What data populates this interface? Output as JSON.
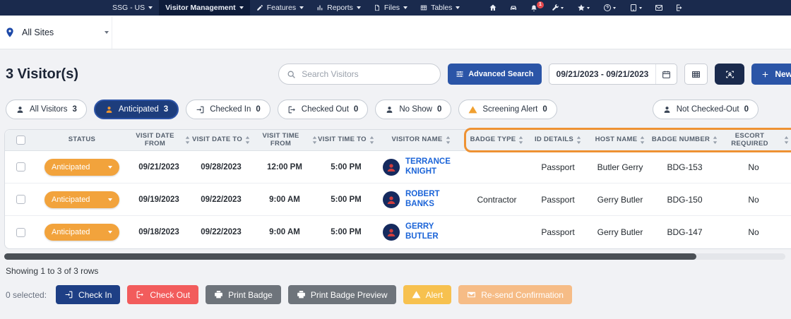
{
  "topnav": {
    "site_menu": "SSG - US",
    "module_menu": "Visitor Management",
    "menus": [
      {
        "label": "Features"
      },
      {
        "label": "Reports"
      },
      {
        "label": "Files"
      },
      {
        "label": "Tables"
      }
    ],
    "notification_count": "1"
  },
  "sitebar": {
    "site_selector": "All Sites"
  },
  "toolbar": {
    "title": "3 Visitor(s)",
    "search_placeholder": "Search Visitors",
    "advanced_search": "Advanced Search",
    "date_range": "09/21/2023 - 09/21/2023",
    "new_button": "New"
  },
  "filters": [
    {
      "label": "All Visitors",
      "count": "3"
    },
    {
      "label": "Anticipated",
      "count": "3"
    },
    {
      "label": "Checked In",
      "count": "0"
    },
    {
      "label": "Checked Out",
      "count": "0"
    },
    {
      "label": "No Show",
      "count": "0"
    },
    {
      "label": "Screening Alert",
      "count": "0"
    },
    {
      "label": "Not Checked-Out",
      "count": "0"
    }
  ],
  "table": {
    "columns": [
      "STATUS",
      "VISIT DATE FROM",
      "VISIT DATE TO",
      "VISIT TIME FROM",
      "VISIT TIME TO",
      "VISITOR NAME",
      "BADGE TYPE",
      "ID DETAILS",
      "HOST NAME",
      "BADGE NUMBER",
      "ESCORT REQUIRED"
    ],
    "rows": [
      {
        "status": "Anticipated",
        "visit_date_from": "09/21/2023",
        "visit_date_to": "09/28/2023",
        "visit_time_from": "12:00 PM",
        "visit_time_to": "5:00 PM",
        "visitor_name": "TERRANCE KNIGHT",
        "badge_type": "",
        "id_details": "Passport",
        "host_name": "Butler Gerry",
        "badge_number": "BDG-153",
        "escort_required": "No"
      },
      {
        "status": "Anticipated",
        "visit_date_from": "09/19/2023",
        "visit_date_to": "09/22/2023",
        "visit_time_from": "9:00 AM",
        "visit_time_to": "5:00 PM",
        "visitor_name": "ROBERT BANKS",
        "badge_type": "Contractor",
        "id_details": "Passport",
        "host_name": "Gerry Butler",
        "badge_number": "BDG-150",
        "escort_required": "No"
      },
      {
        "status": "Anticipated",
        "visit_date_from": "09/18/2023",
        "visit_date_to": "09/22/2023",
        "visit_time_from": "9:00 AM",
        "visit_time_to": "5:00 PM",
        "visitor_name": "GERRY BUTLER",
        "badge_type": "",
        "id_details": "Passport",
        "host_name": "Gerry Butler",
        "badge_number": "BDG-147",
        "escort_required": "No"
      }
    ]
  },
  "footer": {
    "showing": "Showing 1 to 3 of 3 rows",
    "selected": "0 selected:",
    "check_in": "Check In",
    "check_out": "Check Out",
    "print_badge": "Print Badge",
    "print_badge_preview": "Print Badge Preview",
    "alert": "Alert",
    "resend": "Re-send Confirmation"
  },
  "colors": {
    "navy": "#1a2a4d",
    "accent_blue": "#2b55a7",
    "status_orange": "#f2a33c",
    "highlight_orange": "#ee9233",
    "checkout_red": "#f25c5c",
    "link_blue": "#1b64d8"
  },
  "icons": {
    "location": "map-pin",
    "search": "magnifier",
    "advanced_search": "sliders",
    "date_range": "calendar",
    "grid_view": "table-grid",
    "badge_scan": "person-in-brackets",
    "new": "plus",
    "notifications": "bell",
    "sort": "up-down-arrows",
    "status_menu": "chevron-down",
    "check_in": "arrow-into-box",
    "check_out": "arrow-out-of-box",
    "print": "printer",
    "alert": "warning-triangle",
    "resend": "envelope"
  }
}
